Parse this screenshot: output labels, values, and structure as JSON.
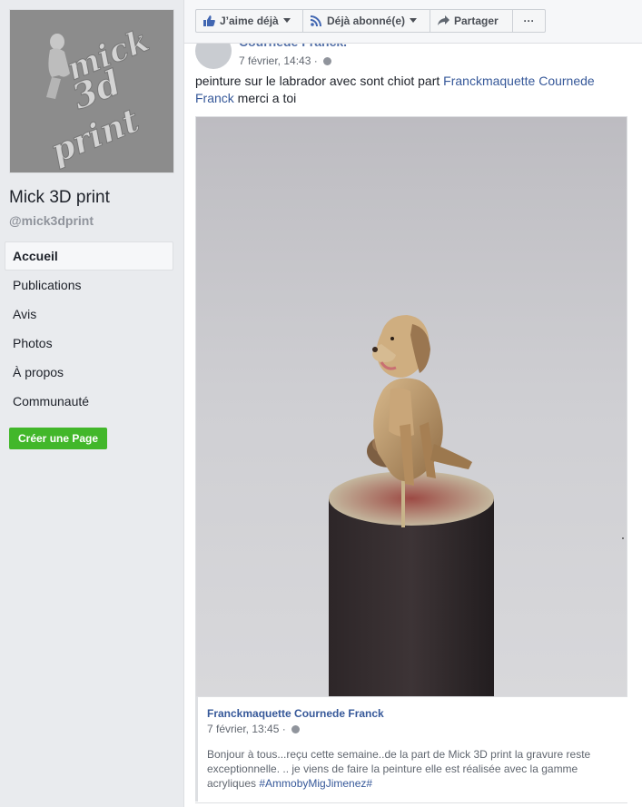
{
  "sidebar": {
    "logo_text": [
      "mick",
      "3d",
      "print"
    ],
    "page_name": "Mick 3D print",
    "handle": "@mick3dprint",
    "nav": [
      {
        "label": "Accueil",
        "active": true
      },
      {
        "label": "Publications",
        "active": false
      },
      {
        "label": "Avis",
        "active": false
      },
      {
        "label": "Photos",
        "active": false
      },
      {
        "label": "À propos",
        "active": false
      },
      {
        "label": "Communauté",
        "active": false
      }
    ],
    "create_page": "Créer une Page"
  },
  "actions": {
    "like": "J’aime déjà",
    "follow": "Déjà abonné(e)",
    "share": "Partager",
    "more": "···"
  },
  "post": {
    "author": "Cournede Franck.",
    "time": "7 février, 14:43 ·",
    "text_plain": "peinture sur le labrador avec sont chiot part ",
    "text_link": "Franckmaquette Cournede Franck",
    "text_end": " merci a toi"
  },
  "shared": {
    "author": "Franckmaquette Cournede Franck",
    "time": "7 février, 13:45 ·",
    "text": "Bonjour à tous...reçu cette semaine..de la part de Mick 3D print la gravure reste exceptionnelle. .. je viens de faire la peinture elle est réalisée avec la gamme acryliques ",
    "hashtag": "#AmmobyMigJimenez#"
  },
  "colors": {
    "link": "#365899",
    "create_button": "#42b72a",
    "background": "#e9ebee"
  }
}
